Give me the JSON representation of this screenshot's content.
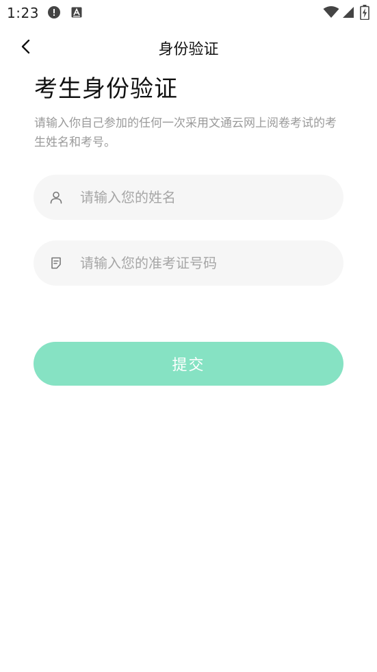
{
  "status_bar": {
    "time": "1:23",
    "icons": [
      "alert-icon",
      "a-badge-icon",
      "wifi-icon",
      "signal-icon",
      "battery-charging-icon"
    ]
  },
  "nav": {
    "title": "身份验证",
    "back_icon": "chevron-left-icon"
  },
  "heading": {
    "title": "考生身份验证",
    "description": "请输入你自己参加的任何一次采用文通云网上阅卷考试的考生姓名和考号。"
  },
  "form": {
    "name_field": {
      "placeholder": "请输入您的姓名",
      "value": "",
      "icon": "user-icon"
    },
    "id_field": {
      "placeholder": "请输入您的准考证号码",
      "value": "",
      "icon": "id-card-icon"
    },
    "submit_label": "提交"
  },
  "colors": {
    "accent": "#86e2c3",
    "input_bg": "#f6f6f6",
    "placeholder": "#a6a6a6",
    "description": "#9a9a9a"
  }
}
